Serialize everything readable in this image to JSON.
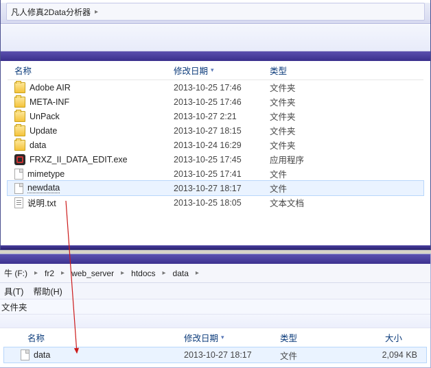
{
  "window1": {
    "breadcrumb": {
      "item1": "凡人修真2Data分析器",
      "tail": ""
    },
    "headers": {
      "name": "名称",
      "date": "修改日期",
      "type": "类型"
    },
    "rows": [
      {
        "icon": "folder",
        "name": "Adobe AIR",
        "date": "2013-10-25 17:46",
        "type": "文件夹",
        "selected": false
      },
      {
        "icon": "folder",
        "name": "META-INF",
        "date": "2013-10-25 17:46",
        "type": "文件夹",
        "selected": false
      },
      {
        "icon": "folder",
        "name": "UnPack",
        "date": "2013-10-27 2:21",
        "type": "文件夹",
        "selected": false
      },
      {
        "icon": "folder",
        "name": "Update",
        "date": "2013-10-27 18:15",
        "type": "文件夹",
        "selected": false
      },
      {
        "icon": "folder",
        "name": "data",
        "date": "2013-10-24 16:29",
        "type": "文件夹",
        "selected": false
      },
      {
        "icon": "exe",
        "name": "FRXZ_II_DATA_EDIT.exe",
        "date": "2013-10-25 17:45",
        "type": "应用程序",
        "selected": false
      },
      {
        "icon": "file",
        "name": "mimetype",
        "date": "2013-10-25 17:41",
        "type": "文件",
        "selected": false
      },
      {
        "icon": "file",
        "name": "newdata",
        "date": "2013-10-27 18:17",
        "type": "文件",
        "selected": true
      },
      {
        "icon": "txt",
        "name": "说明.txt",
        "date": "2013-10-25 18:05",
        "type": "文本文档",
        "selected": false
      }
    ]
  },
  "window2": {
    "breadcrumb": {
      "seg0": "牛 (F:)",
      "seg1": "fr2",
      "seg2": "web_server",
      "seg3": "htdocs",
      "seg4": "data"
    },
    "menu": {
      "tools": "具(T)",
      "help": "帮助(H)"
    },
    "toolbar": {
      "folder": "文件夹"
    },
    "headers": {
      "name": "名称",
      "date": "修改日期",
      "type": "类型",
      "size": "大小"
    },
    "rows": [
      {
        "icon": "file",
        "name": "data",
        "date": "2013-10-27 18:17",
        "type": "文件",
        "size": "2,094 KB",
        "selected": true
      }
    ]
  },
  "glyphs": {
    "sep": "▸",
    "sort": "▾"
  }
}
